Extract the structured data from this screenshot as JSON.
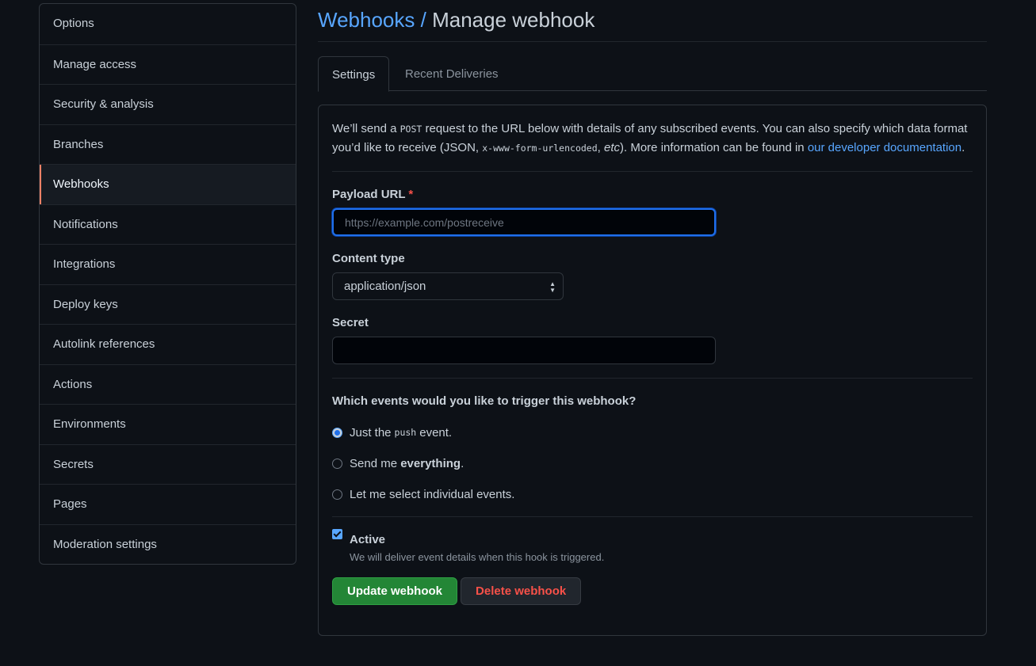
{
  "sidebar": {
    "items": [
      {
        "label": "Options"
      },
      {
        "label": "Manage access"
      },
      {
        "label": "Security & analysis"
      },
      {
        "label": "Branches"
      },
      {
        "label": "Webhooks",
        "selected": true
      },
      {
        "label": "Notifications"
      },
      {
        "label": "Integrations"
      },
      {
        "label": "Deploy keys"
      },
      {
        "label": "Autolink references"
      },
      {
        "label": "Actions"
      },
      {
        "label": "Environments"
      },
      {
        "label": "Secrets"
      },
      {
        "label": "Pages"
      },
      {
        "label": "Moderation settings"
      }
    ]
  },
  "header": {
    "breadcrumb_link": "Webhooks",
    "separator": "/",
    "title": "Manage webhook"
  },
  "tabs": [
    {
      "label": "Settings",
      "active": true
    },
    {
      "label": "Recent Deliveries",
      "active": false
    }
  ],
  "intro": {
    "part1": "We’ll send a ",
    "code1": "POST",
    "part2": " request to the URL below with details of any subscribed events. You can also specify which data format you’d like to receive (JSON, ",
    "code2": "x-www-form-urlencoded",
    "part3": ", ",
    "em": "etc",
    "part4": "). More information can be found in ",
    "link": "our developer documentation",
    "part5": "."
  },
  "payload": {
    "label": "Payload URL",
    "required_mark": "*",
    "placeholder": "https://example.com/postreceive",
    "value": ""
  },
  "content_type": {
    "label": "Content type",
    "selected": "application/json"
  },
  "secret": {
    "label": "Secret",
    "value": ""
  },
  "events": {
    "question": "Which events would you like to trigger this webhook?",
    "opt1_pre": "Just the",
    "opt1_code": "push",
    "opt1_post": "event.",
    "opt2_pre": "Send me ",
    "opt2_bold": "everything",
    "opt2_post": ".",
    "opt3": "Let me select individual events."
  },
  "active": {
    "label": "Active",
    "note": "We will deliver event details when this hook is triggered."
  },
  "buttons": {
    "update": "Update webhook",
    "delete": "Delete webhook"
  },
  "colors": {
    "background": "#0d1117",
    "accent_link": "#58a6ff",
    "selected_marker": "#f78166",
    "primary_button": "#238636",
    "danger_text": "#f85149"
  }
}
